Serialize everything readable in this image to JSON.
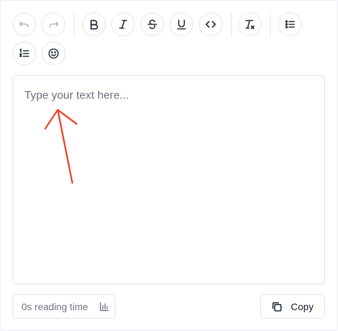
{
  "toolbar": {
    "buttons": [
      {
        "name": "undo",
        "icon": "undo-icon",
        "enabled": false
      },
      {
        "name": "redo",
        "icon": "redo-icon",
        "enabled": false
      },
      {
        "name": "bold",
        "icon": "bold-icon",
        "enabled": true
      },
      {
        "name": "italic",
        "icon": "italic-icon",
        "enabled": true
      },
      {
        "name": "strikethrough",
        "icon": "strikethrough-icon",
        "enabled": true
      },
      {
        "name": "underline",
        "icon": "underline-icon",
        "enabled": true
      },
      {
        "name": "code",
        "icon": "code-icon",
        "enabled": true
      },
      {
        "name": "clear-formatting",
        "icon": "clear-format-icon",
        "enabled": true
      },
      {
        "name": "bullet-list",
        "icon": "bullet-list-icon",
        "enabled": true
      },
      {
        "name": "numbered-list",
        "icon": "numbered-list-icon",
        "enabled": true
      },
      {
        "name": "emoji",
        "icon": "emoji-icon",
        "enabled": true
      }
    ]
  },
  "editor": {
    "placeholder": "Type your text here...",
    "value": ""
  },
  "annotation": {
    "icon": "arrow-icon",
    "color": "#e8462c"
  },
  "footer": {
    "reading_time": "0s reading time",
    "reading_icon": "bar-chart-icon",
    "copy_label": "Copy",
    "copy_icon": "copy-icon"
  },
  "colors": {
    "border": "#e4e4e7",
    "muted_text": "#6b7280",
    "text": "#111827",
    "disabled_icon": "#b5b5bb"
  }
}
